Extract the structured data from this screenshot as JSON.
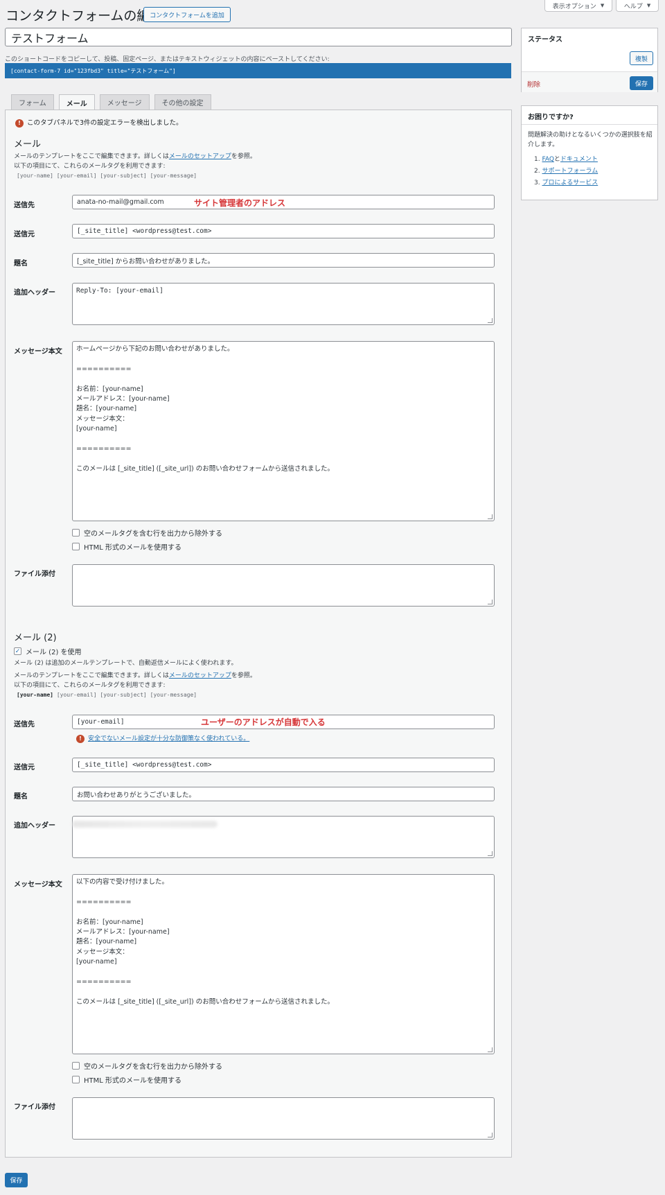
{
  "screen_options": "表示オプション",
  "help": "ヘルプ",
  "page_title": "コンタクトフォームの編集",
  "add_new": "コンタクトフォームを追加",
  "form_title": "テストフォーム",
  "shortcode_label": "このショートコードをコピーして、投稿、固定ページ、またはテキストウィジェットの内容にペーストしてください:",
  "shortcode": "[contact-form-7 id=\"123fbd3\" title=\"テストフォーム\"]",
  "tabs": [
    "フォーム",
    "メール",
    "メッセージ",
    "その他の設定"
  ],
  "active_tab": "メール",
  "error_notice": "このタブパネルで3件の設定エラーを検出しました。",
  "mail": {
    "heading": "メール",
    "intro_prefix": "メールのテンプレートをここで編集できます。詳しくは",
    "intro_link": "メールのセットアップ",
    "intro_suffix": "を参照。",
    "tags_intro": "以下の項目にて、これらのメールタグを利用できます:",
    "tags": "[your-name] [your-email] [your-subject] [your-message]",
    "to_label": "送信先",
    "to_value": "anata-no-mail@gmail.com",
    "to_annotation": "サイト管理者のアドレス",
    "from_label": "送信元",
    "from_value": "[_site_title] <wordpress@test.com>",
    "subject_label": "題名",
    "subject_value": "[_site_title] からお問い合わせがありました。",
    "headers_label": "追加ヘッダー",
    "headers_value": "Reply-To: [your-email]",
    "body_label": "メッセージ本文",
    "body_value": "ホームページから下記のお問い合わせがありました。\n\n==========\n\nお名前：[your-name]\nメールアドレス：[your-name]\n題名：[your-name]\nメッセージ本文：\n[your-name]\n\n==========\n\nこのメールは [_site_title] ([_site_url]) のお問い合わせフォームから送信されました。",
    "exclude_blank": "空のメールタグを含む行を出力から除外する",
    "use_html": "HTML 形式のメールを使用する",
    "attachments_label": "ファイル添付"
  },
  "mail2": {
    "heading": "メール (2)",
    "use_label": "メール (2) を使用",
    "use_checked": true,
    "description": "メール (2) は追加のメールテンプレートで、自動返信メールによく使われます。",
    "intro_prefix": "メールのテンプレートをここで編集できます。詳しくは",
    "intro_link": "メールのセットアップ",
    "intro_suffix": "を参照。",
    "tags_intro": "以下の項目にて、これらのメールタグを利用できます:",
    "tag_bold": "[your-name]",
    "tags_rest": "[your-email] [your-subject] [your-message]",
    "to_label": "送信先",
    "to_value": "[your-email]",
    "to_annotation": "ユーザーのアドレスが自動で入る",
    "to_warning": "安全でないメール設定が十分な防御策なく使われている。",
    "from_label": "送信元",
    "from_value": "[_site_title] <wordpress@test.com>",
    "subject_label": "題名",
    "subject_value": "お問い合わせありがとうございました。",
    "headers_label": "追加ヘッダー",
    "body_label": "メッセージ本文",
    "body_value": "以下の内容で受け付けました。\n\n==========\n\nお名前：[your-name]\nメールアドレス：[your-name]\n題名：[your-name]\nメッセージ本文：\n[your-name]\n\n==========\n\nこのメールは [_site_title] ([_site_url]) のお問い合わせフォームから送信されました。",
    "exclude_blank": "空のメールタグを含む行を出力から除外する",
    "use_html": "HTML 形式のメールを使用する",
    "attachments_label": "ファイル添付"
  },
  "save_bottom": "保存",
  "status_box": {
    "title": "ステータス",
    "duplicate": "複製",
    "delete": "削除",
    "save": "保存"
  },
  "help_box": {
    "title": "お困りですか?",
    "text": "問題解決の助けとなるいくつかの選択肢を紹介します。",
    "items": [
      {
        "num": "1.",
        "a": "FAQ",
        "mid": "と",
        "b": "ドキュメント"
      },
      {
        "num": "2.",
        "a": "サポートフォーラム"
      },
      {
        "num": "3.",
        "a": "プロによるサービス"
      }
    ]
  },
  "colors": {
    "accent": "#2271b1",
    "annotation": "#d63638",
    "error": "#c34a2c"
  }
}
